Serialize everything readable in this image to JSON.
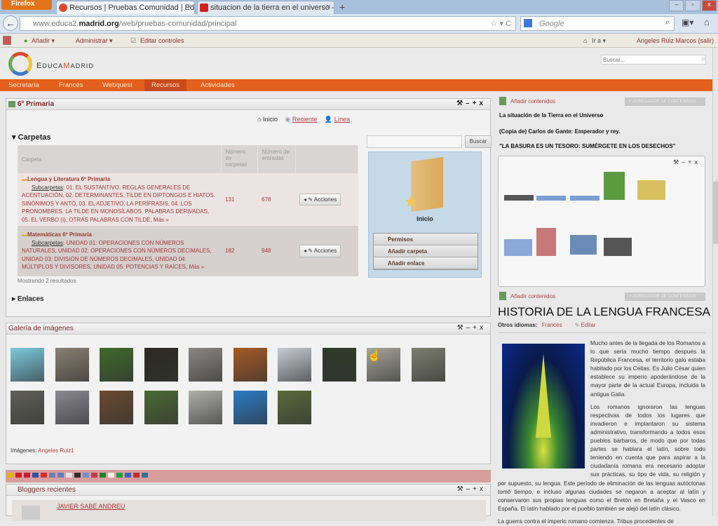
{
  "browser": {
    "menu_label": "Firefox",
    "tabs": [
      {
        "title": "Recursos | Pruebas Comunidad | Edu..."
      },
      {
        "title": "situacion de la tierra en el universo - ..."
      }
    ],
    "new_tab": "+",
    "url_prefix": "www.educa2.",
    "url_domain": "madrid.org",
    "url_path": "/web/pruebas-comunidad/principal",
    "search_engine": "Google"
  },
  "toolbar": {
    "add": "Añadir ▾",
    "manage": "Administrar ▾",
    "edit_controls": "Editar controles",
    "goto": "Ir a ▾",
    "user": "Angeles Ruiz Marcos (salir)"
  },
  "site": {
    "logo_text_a": "E",
    "logo_text_b": "DUCA",
    "logo_text_c": "M",
    "logo_text_d": "ADRID",
    "search_placeholder": "Buscar..."
  },
  "nav": [
    {
      "label": "Secretaría"
    },
    {
      "label": "Francés"
    },
    {
      "label": "Webquest"
    },
    {
      "label": "Recursos"
    },
    {
      "label": "Actividades"
    }
  ],
  "library": {
    "title": "6º Primaria",
    "links": [
      "Inicio",
      "Reciente",
      "Línea"
    ],
    "section": "Carpetas",
    "headers": [
      "Carpeta",
      "Número de carpetas",
      "Número de entradas"
    ],
    "rows": [
      {
        "name": "Lengua y Literatura 6º Primaria",
        "sub_label": "Subcarpetas",
        "sub": ": 01. EL SUSTANTIVO. REGLAS GENERALES DE ACENTUACIÓN, 02. DETERMINANTES. TILDE EN DIPTONGOS E HIATOS. SINÓNIMOS Y ANTÓ, 03. EL ADJETIVO. LA PERÍFRASIS, 04. LOS PRONOMBRES. LA TILDE EN MONOSÍLABOS. PALABRAS DERIVADAS, 05. EL VERBO (I). OTRAS PALABRAS CON TILDE, Más »",
        "folders": "131",
        "entries": "678",
        "action": "Acciones"
      },
      {
        "name": "Matemáticas 6º Primaria",
        "sub_label": "Subcarpetas",
        "sub": ": UNIDAD 01: OPERACIONES CON NÚMEROS NATURALES, UNIDAD 02: OPERACIONES CON NÚMEROS DECIMALES, UNIDAD 03: DIVISIÓN DE NÚMEROS DECIMALES, UNIDAD 04: MÚLTIPLOS Y DIVISORES, UNIDAD 05: POTENCIAS Y RAÍCES, Más »",
        "folders": "182",
        "entries": "948",
        "action": "Acciones"
      }
    ],
    "results": "Mostrando 2 resultados",
    "links_section": "Enlaces",
    "search_button": "Buscar",
    "folder_label": "Inicio",
    "menu": [
      "Permisos",
      "Añadir carpeta",
      "Añadir enlace"
    ]
  },
  "gallery": {
    "title": "Galería de imágenes",
    "images": [
      "#7ccbe0",
      "#8a8070",
      "#3f6a2a",
      "#2a2a20",
      "#8a8886",
      "#a55a25",
      "#c8ccd2",
      "#2e3a28",
      "#a6a69a",
      "#7d7f70",
      "#606058",
      "#8a8a90",
      "#6a4a30",
      "#4a6a35",
      "#b0b0aa",
      "#2a7bc8",
      "#5a6a3a"
    ],
    "credit_label": "Imágenes:",
    "credit_user": "Angeles Ruiz1"
  },
  "flags": [
    "#e8b000",
    "#d02020",
    "#c02030",
    "#3050a0",
    "#d03030",
    "#7080b0",
    "#6080c0",
    "#e0e0f0",
    "#303030",
    "#7090d0",
    "#c04040",
    "#208030",
    "#f0f0f0",
    "#20a040",
    "#4060c0",
    "#c03030",
    "#3070a0"
  ],
  "bloggers": {
    "title": "Bloggers recientes",
    "first": "JAVIER SABE ANDREU"
  },
  "right": {
    "add_content": "Añadir contenidos",
    "gray_button": "+ AGREGADOR DE CONTENIDOS",
    "items": [
      "La situación de la Tierra en el Universo",
      "(Copia de) Carlos de Gante: Emperador y rey.",
      "\"LA BASURA ES UN TESORO: SUMÉRGETE EN LOS DESECHOS\""
    ],
    "article_title": "HISTORIA DE LA LENGUA FRANCESA",
    "other_lang_label": "Otros idiomas:",
    "other_lang": "Francés",
    "edit": "Editar",
    "p1": "Mucho antes de la llegada de los Romanos a lo que sería mucho tiempo después la República Francesa, el territorio galo estaba habitado por los Celtas. Es Julio César quien establece su imperio apoderándose de la mayor parte de la actual Europa, incluida la antigua Galia.",
    "p2": "Los romanos ignoraron las lenguas respectivas de todos los lugares que invadieron e implantaron su sistema administrativo, transformando a todos esos pueblos bárbaros, de modo que por todas partes se hablara el latín, sobre todo teniendo en cuenta que para aspirar a la ciudadanía romana era necesario adoptar sus prácticas, su tipo de vida, su religión y por supuesto, su lengua. Este período de eliminación de las lenguas autóctonas tomó tiempo, e incluso algunas ciudades se negaron a aceptar al latín y conservaron sus propias lenguas como el Bretón en Bretaña y el Vasco en España. El latín hablado por el pueblo también se alejó del latín clásico.",
    "p3": "La guerra contra el imperio romano comienza. Tribus procedentes de"
  }
}
